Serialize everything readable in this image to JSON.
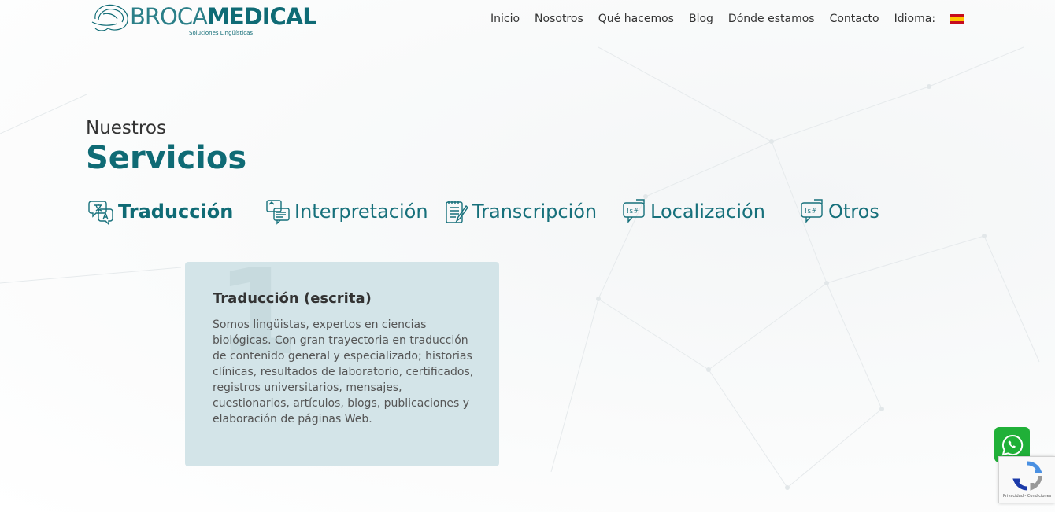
{
  "header": {
    "logo": {
      "brand_a": "BROCA",
      "brand_b": "MEDICAL",
      "tagline": "Soluciones Lingüísticas"
    },
    "nav": [
      {
        "label": "Inicio"
      },
      {
        "label": "Nosotros"
      },
      {
        "label": "Qué hacemos"
      },
      {
        "label": "Blog"
      },
      {
        "label": "Dónde estamos"
      },
      {
        "label": "Contacto"
      }
    ],
    "language_label": "Idioma:",
    "language_flag_icon": "spain-flag-icon"
  },
  "section": {
    "pre_title": "Nuestros",
    "title": "Servicios"
  },
  "tabs": [
    {
      "label": "Traducción",
      "icon": "translate-icon",
      "active": true
    },
    {
      "label": "Interpretación",
      "icon": "interpretation-icon",
      "active": false
    },
    {
      "label": "Transcripción",
      "icon": "notepad-icon",
      "active": false
    },
    {
      "label": "Localización",
      "icon": "chat-code-icon",
      "active": false
    },
    {
      "label": "Otros",
      "icon": "chat-code-icon",
      "active": false
    }
  ],
  "card": {
    "number": "1",
    "title": "Traducción (escrita)",
    "text": "Somos lingüistas, expertos en ciencias biológicas. Con gran trayectoria en traducción de contenido general y especializado; historias clínicas, resultados de laboratorio, certificados, registros universitarios, mensajes, cuestionarios, artículos, blogs, publicaciones y elaboración de páginas Web."
  },
  "floating": {
    "whatsapp_icon": "whatsapp-icon",
    "recaptcha_text": "Privacidad - Condiciones"
  },
  "colors": {
    "brand": "#0f6b75",
    "card_bg": "#d3e4e8",
    "whatsapp": "#20b038"
  }
}
